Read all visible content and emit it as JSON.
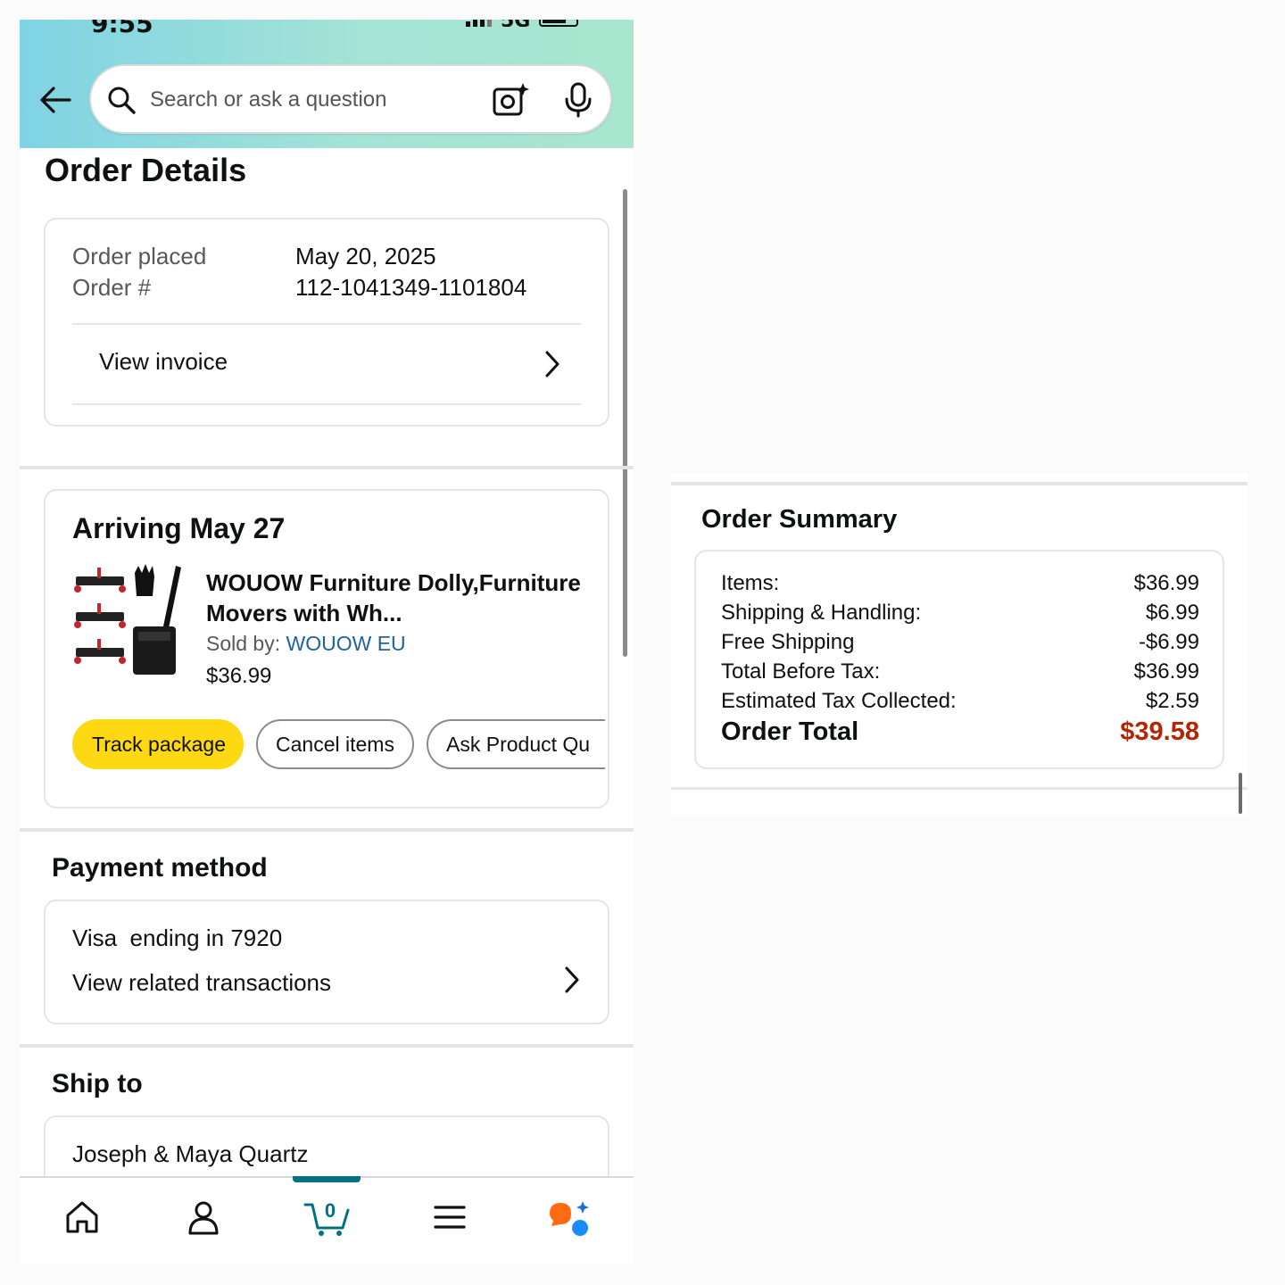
{
  "status": {
    "time": "9:55",
    "network": "5G"
  },
  "search": {
    "placeholder": "Search or ask a question"
  },
  "page": {
    "title": "Order Details"
  },
  "order_info": {
    "placed_label": "Order placed",
    "placed_value": "May 20, 2025",
    "number_label": "Order #",
    "number_value": "112-1041349-1101804",
    "view_invoice": "View invoice"
  },
  "shipment": {
    "title": "Arriving May 27",
    "product_name": "WOUOW Furniture Dolly,Furniture Movers with Wh...",
    "sold_by_label": "Sold by:",
    "seller": "WOUOW EU",
    "price": "$36.99",
    "buttons": {
      "track": "Track package",
      "cancel": "Cancel items",
      "ask": "Ask Product Qu"
    }
  },
  "payment": {
    "title": "Payment method",
    "card": "Visa  ending in 7920",
    "related": "View related transactions"
  },
  "ship_to": {
    "title": "Ship to",
    "name": "Joseph & Maya Quartz"
  },
  "nav": {
    "cart_count": "0",
    "items": [
      "home-icon",
      "account-icon",
      "cart-icon",
      "menu-icon",
      "rufus-icon"
    ]
  },
  "order_summary": {
    "title": "Order Summary",
    "rows": [
      {
        "label": "Items:",
        "value": "$36.99"
      },
      {
        "label": "Shipping & Handling:",
        "value": "$6.99"
      },
      {
        "label": "Free Shipping",
        "value": "-$6.99"
      },
      {
        "label": "Total Before Tax:",
        "value": "$36.99"
      },
      {
        "label": "Estimated Tax Collected:",
        "value": "$2.59"
      }
    ],
    "total_label": "Order Total",
    "total_value": "$39.58"
  },
  "colors": {
    "accent_yellow": "#ffd814",
    "link_blue": "#2162a1",
    "price_red": "#b12704",
    "cart_teal": "#007185"
  }
}
